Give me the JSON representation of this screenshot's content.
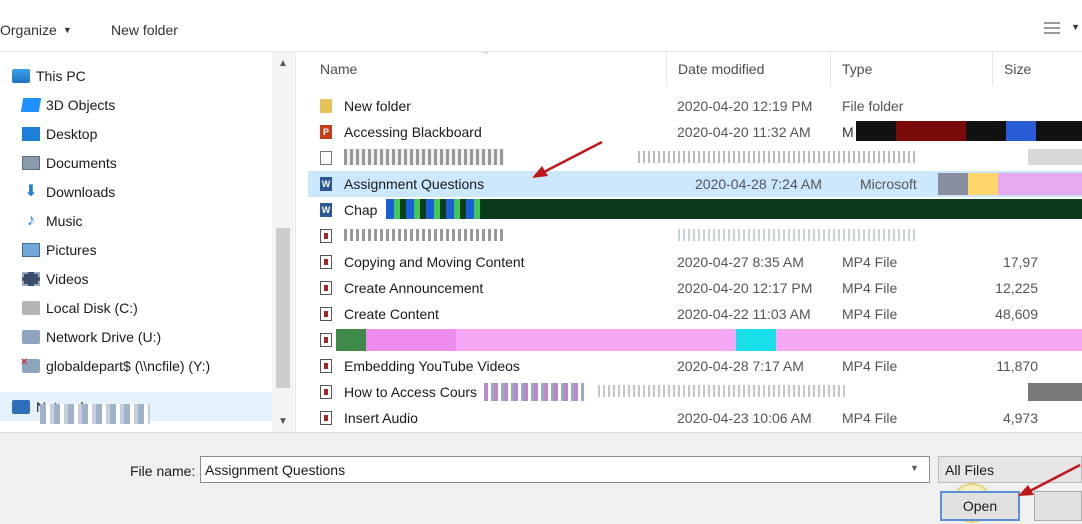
{
  "toolbar": {
    "organize_label": "Organize",
    "new_folder_label": "New folder"
  },
  "nav": {
    "this_pc": "This PC",
    "items": [
      {
        "label": "3D Objects",
        "icon": "cube-icon"
      },
      {
        "label": "Desktop",
        "icon": "desktop-icon"
      },
      {
        "label": "Documents",
        "icon": "documents-icon"
      },
      {
        "label": "Downloads",
        "icon": "download-arrow-icon"
      },
      {
        "label": "Music",
        "icon": "music-note-icon"
      },
      {
        "label": "Pictures",
        "icon": "pictures-icon"
      },
      {
        "label": "Videos",
        "icon": "videos-icon"
      },
      {
        "label": "Local Disk (C:)",
        "icon": "disk-drive-icon"
      },
      {
        "label": "Network Drive (U:)",
        "icon": "network-drive-icon"
      },
      {
        "label": "globaldepart$ (\\\\ncfile) (Y:)",
        "icon": "disconnected-drive-icon"
      }
    ],
    "network": "Network"
  },
  "columns": {
    "name": "Name",
    "date": "Date modified",
    "type": "Type",
    "size": "Size"
  },
  "files": [
    {
      "name": "New folder",
      "date": "2020-04-20 12:19 PM",
      "type": "File folder",
      "size": "",
      "kind": "folder"
    },
    {
      "name": "Accessing Blackboard",
      "date": "2020-04-20 11:32 AM",
      "type": "",
      "size": "",
      "kind": "ppt"
    },
    {
      "name": "",
      "date": "",
      "type": "",
      "size": "",
      "kind": "img"
    },
    {
      "name": "Assignment Questions",
      "date": "2020-04-28 7:24 AM",
      "type": "Microsoft",
      "size": "",
      "kind": "word"
    },
    {
      "name": "Chap",
      "date": "",
      "type": "",
      "size": "",
      "kind": "word"
    },
    {
      "name": "",
      "date": "",
      "type": "",
      "size": "",
      "kind": "mp4"
    },
    {
      "name": "Copying and Moving Content",
      "date": "2020-04-27 8:35 AM",
      "type": "MP4 File",
      "size": "17,97",
      "kind": "mp4"
    },
    {
      "name": "Create Announcement",
      "date": "2020-04-20 12:17 PM",
      "type": "MP4 File",
      "size": "12,225",
      "kind": "mp4"
    },
    {
      "name": "Create Content",
      "date": "2020-04-22 11:03 AM",
      "type": "MP4 File",
      "size": "48,609",
      "kind": "mp4"
    },
    {
      "name": "",
      "date": "",
      "type": "",
      "size": "",
      "kind": "mp4"
    },
    {
      "name": "Embedding YouTube Videos",
      "date": "2020-04-28 7:17 AM",
      "type": "MP4 File",
      "size": "11,870",
      "kind": "mp4"
    },
    {
      "name": "How to Access Cours",
      "date": "",
      "type": "",
      "size": "",
      "kind": "mp4"
    },
    {
      "name": "Insert Audio",
      "date": "2020-04-23 10:06 AM",
      "type": "MP4 File",
      "size": "4,973",
      "kind": "mp4"
    }
  ],
  "footer": {
    "file_name_label": "File name:",
    "file_name_value": "Assignment Questions",
    "filter_label": "All Files",
    "open_label": "Open"
  },
  "colors": {
    "selection": "#cce8ff",
    "annotation_arrow": "#c0171b"
  }
}
